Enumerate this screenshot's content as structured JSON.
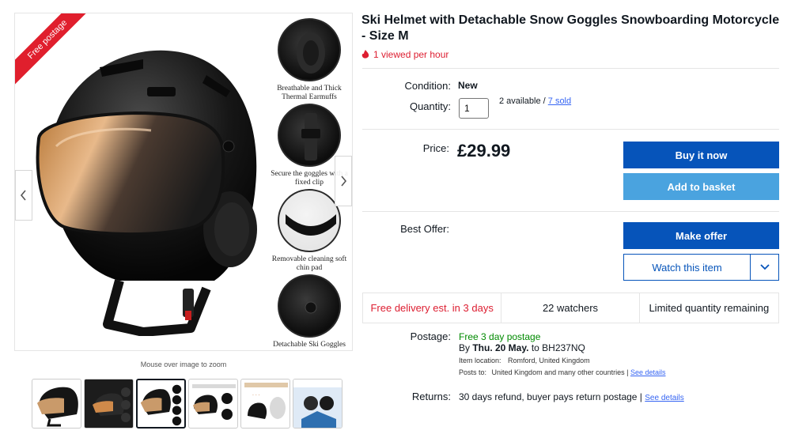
{
  "gallery": {
    "ribbon": "Free postage",
    "features": [
      {
        "caption": "Breathable and Thick Thermal Earmuffs"
      },
      {
        "caption": "Secure the goggles with a fixed clip"
      },
      {
        "caption": "Removable cleaning soft chin pad"
      },
      {
        "caption": "Detachable Ski Goggles"
      }
    ],
    "zoom_hint": "Mouse over image to zoom",
    "thumbnail_count": 6
  },
  "product": {
    "title": "Ski Helmet with Detachable Snow Goggles Snowboarding Motorcycle - Size M",
    "viewed": "1 viewed per hour",
    "condition_label": "Condition:",
    "condition_value": "New",
    "quantity_label": "Quantity:",
    "quantity_value": "1",
    "available": "2 available / ",
    "sold": "7 sold",
    "price_label": "Price:",
    "price": "£29.99",
    "best_offer_label": "Best Offer:"
  },
  "actions": {
    "buy_now": "Buy it now",
    "add_to_basket": "Add to basket",
    "make_offer": "Make offer",
    "watch": "Watch this item"
  },
  "info_bar": {
    "delivery": "Free delivery est. in 3 days",
    "watchers": "22 watchers",
    "limited": "Limited quantity remaining"
  },
  "postage": {
    "label": "Postage:",
    "method": "Free 3 day postage",
    "by": "By ",
    "date": "Thu. 20 May.",
    "to": " to BH237NQ",
    "location_label": "Item location:",
    "location": "Romford, United Kingdom",
    "posts_to_label": "Posts to:",
    "posts_to": "United Kingdom and many other countries | ",
    "see_details": "See details"
  },
  "returns": {
    "label": "Returns:",
    "text": "30 days refund, buyer pays return postage | ",
    "see_details": "See details"
  },
  "colors": {
    "primary": "#0654ba",
    "light_button": "#4aa3df",
    "alert_red": "#dd1e31",
    "green": "#008a00",
    "link": "#3665f3"
  }
}
